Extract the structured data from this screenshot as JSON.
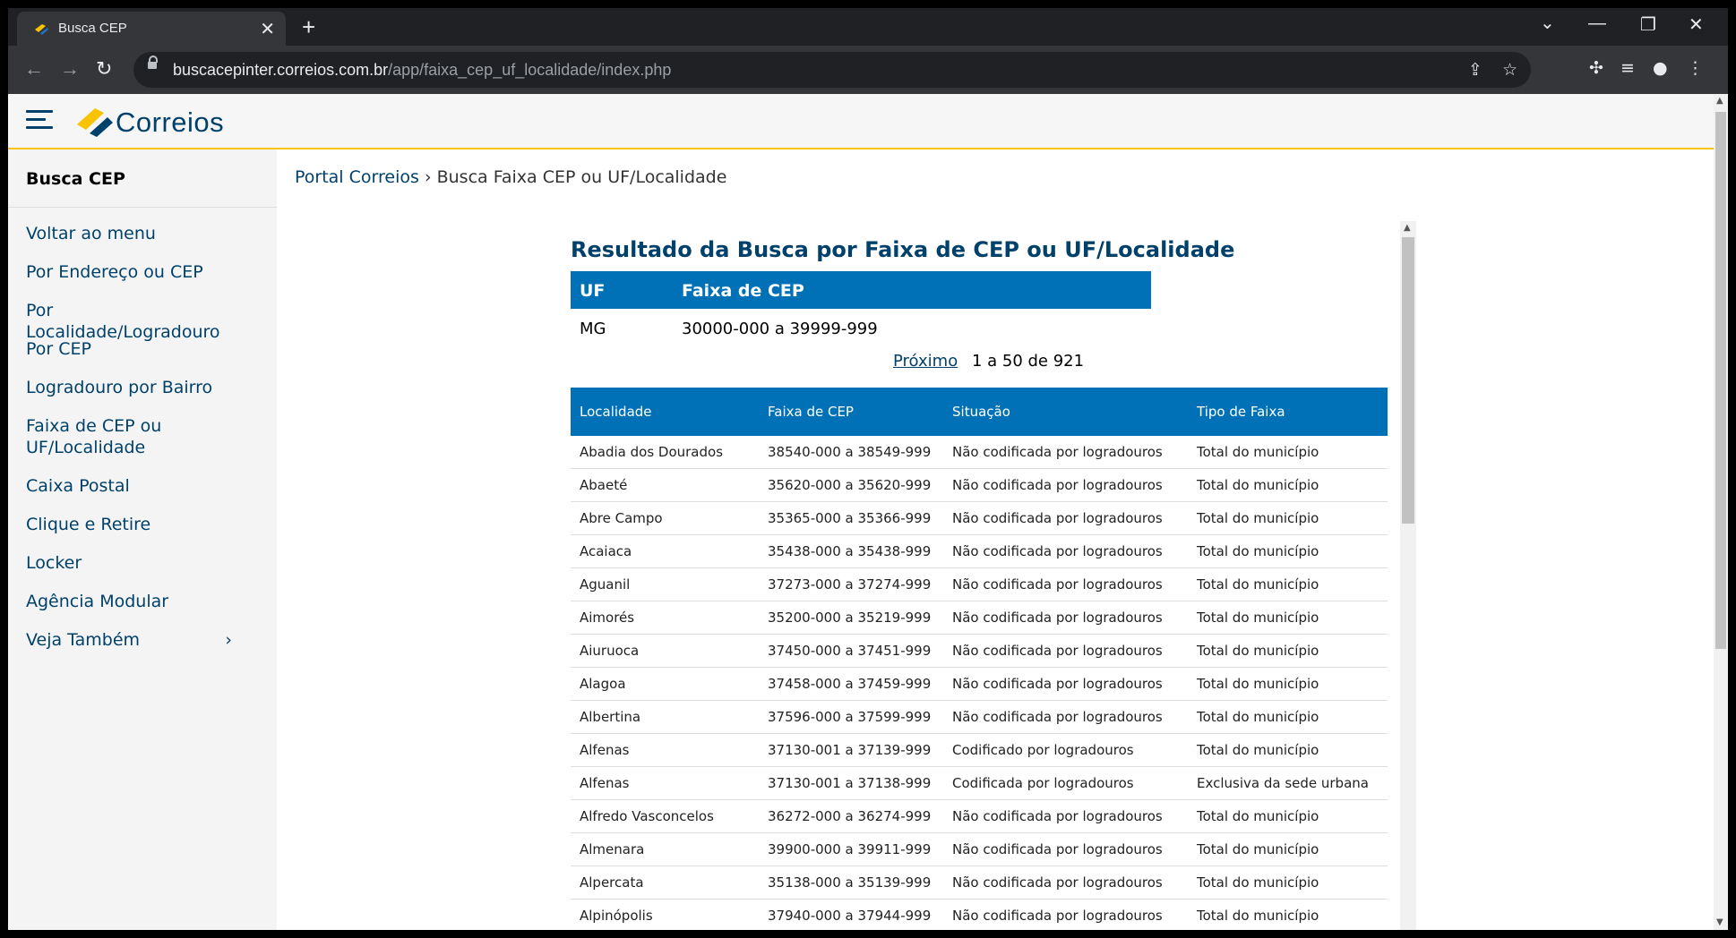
{
  "browser": {
    "tab_title": "Busca CEP",
    "tab_close": "✕",
    "new_tab": "+",
    "url_host": "buscacepinter.correios.com.br",
    "url_path": "/app/faixa_cep_uf_localidade/index.php",
    "icons": [
      "back-icon",
      "forward-icon",
      "reload-icon",
      "lock-icon",
      "share-icon",
      "star-icon",
      "extensions-icon",
      "media-icon",
      "profile-icon",
      "menu-icon"
    ]
  },
  "header": {
    "logo": "Correios"
  },
  "sidebar": {
    "title": "Busca CEP",
    "items": [
      {
        "label": "Voltar ao menu"
      },
      {
        "label": "Por Endereço ou CEP"
      },
      {
        "label": "Por Localidade/Logradouro"
      },
      {
        "label": "Por CEP"
      },
      {
        "label": "Logradouro por Bairro"
      },
      {
        "label": "Faixa de CEP ou UF/Localidade"
      },
      {
        "label": "Caixa Postal"
      },
      {
        "label": "Clique e Retire"
      },
      {
        "label": "Locker"
      },
      {
        "label": "Agência Modular"
      },
      {
        "label": "Veja Também"
      }
    ]
  },
  "breadcrumb": {
    "home": "Portal Correios",
    "separator": "›",
    "current": "Busca Faixa CEP ou UF/Localidade"
  },
  "result": {
    "title": "Resultado da Busca por Faixa de CEP ou UF/Localidade",
    "uf_header": {
      "uf": "UF",
      "faixa": "Faixa de CEP"
    },
    "uf_row": {
      "uf": "MG",
      "faixa": "30000-000 a 39999-999"
    },
    "pager": {
      "next": "Próximo",
      "range": "1 a 50 de 921"
    },
    "columns": [
      "Localidade",
      "Faixa de CEP",
      "Situação",
      "Tipo de Faixa"
    ],
    "rows": [
      [
        "Abadia dos Dourados",
        "38540-000 a 38549-999",
        "Não codificada por logradouros",
        "Total do município"
      ],
      [
        "Abaeté",
        "35620-000 a 35620-999",
        "Não codificada por logradouros",
        "Total do município"
      ],
      [
        "Abre Campo",
        "35365-000 a 35366-999",
        "Não codificada por logradouros",
        "Total do município"
      ],
      [
        "Acaiaca",
        "35438-000 a 35438-999",
        "Não codificada por logradouros",
        "Total do município"
      ],
      [
        "Aguanil",
        "37273-000 a 37274-999",
        "Não codificada por logradouros",
        "Total do município"
      ],
      [
        "Aimorés",
        "35200-000 a 35219-999",
        "Não codificada por logradouros",
        "Total do município"
      ],
      [
        "Aiuruoca",
        "37450-000 a 37451-999",
        "Não codificada por logradouros",
        "Total do município"
      ],
      [
        "Alagoa",
        "37458-000 a 37459-999",
        "Não codificada por logradouros",
        "Total do município"
      ],
      [
        "Albertina",
        "37596-000 a 37599-999",
        "Não codificada por logradouros",
        "Total do município"
      ],
      [
        "Alfenas",
        "37130-001 a 37139-999",
        "Codificado por logradouros",
        "Total do município"
      ],
      [
        "Alfenas",
        "37130-001 a 37138-999",
        "Codificada por logradouros",
        "Exclusiva da sede urbana"
      ],
      [
        "Alfredo Vasconcelos",
        "36272-000 a 36274-999",
        "Não codificada por logradouros",
        "Total do município"
      ],
      [
        "Almenara",
        "39900-000 a 39911-999",
        "Não codificada por logradouros",
        "Total do município"
      ],
      [
        "Alpercata",
        "35138-000 a 35139-999",
        "Não codificada por logradouros",
        "Total do município"
      ],
      [
        "Alpinópolis",
        "37940-000 a 37944-999",
        "Não codificada por logradouros",
        "Total do município"
      ]
    ]
  },
  "colors": {
    "brand_blue": "#00416b",
    "header_blue": "#0071b6",
    "accent_yellow": "#f8c300"
  }
}
